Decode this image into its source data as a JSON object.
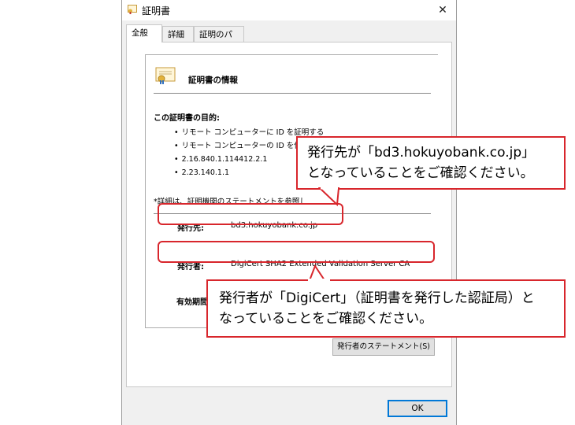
{
  "window": {
    "title": "証明書",
    "close_glyph": "✕"
  },
  "tabs": [
    {
      "label": "全般",
      "active": true
    },
    {
      "label": "詳細",
      "active": false
    },
    {
      "label": "証明のパス",
      "active": false
    }
  ],
  "info": {
    "title": "証明書の情報",
    "purpose_title": "この証明書の目的:",
    "purposes": [
      "リモート コンピューターに ID を証明する",
      "リモート コンピューターの ID を保証する",
      "2.16.840.1.114412.2.1",
      "2.23.140.1.1"
    ],
    "note": "*詳細は、証明機関のステートメントを参照してください。",
    "issued_to_label": "発行先:",
    "issued_to_value": "bd3.hokuyobank.co.jp",
    "issued_by_label": "発行者:",
    "issued_by_value": "DigiCert SHA2 Extended Validation Server CA",
    "validity_label": "有効期間"
  },
  "buttons": {
    "statement": "発行者のステートメント(S)",
    "ok": "OK"
  },
  "callouts": {
    "top_line1": "発行先が「bd3.hokuyobank.co.jp」",
    "top_line2": "となっていることをご確認ください。",
    "bottom_line1": "発行者が「DigiCert」（証明書を発行した認証局）と",
    "bottom_line2": "なっていることをご確認ください。"
  },
  "colors": {
    "highlight": "#d8262c",
    "ok_border": "#0078d7"
  }
}
